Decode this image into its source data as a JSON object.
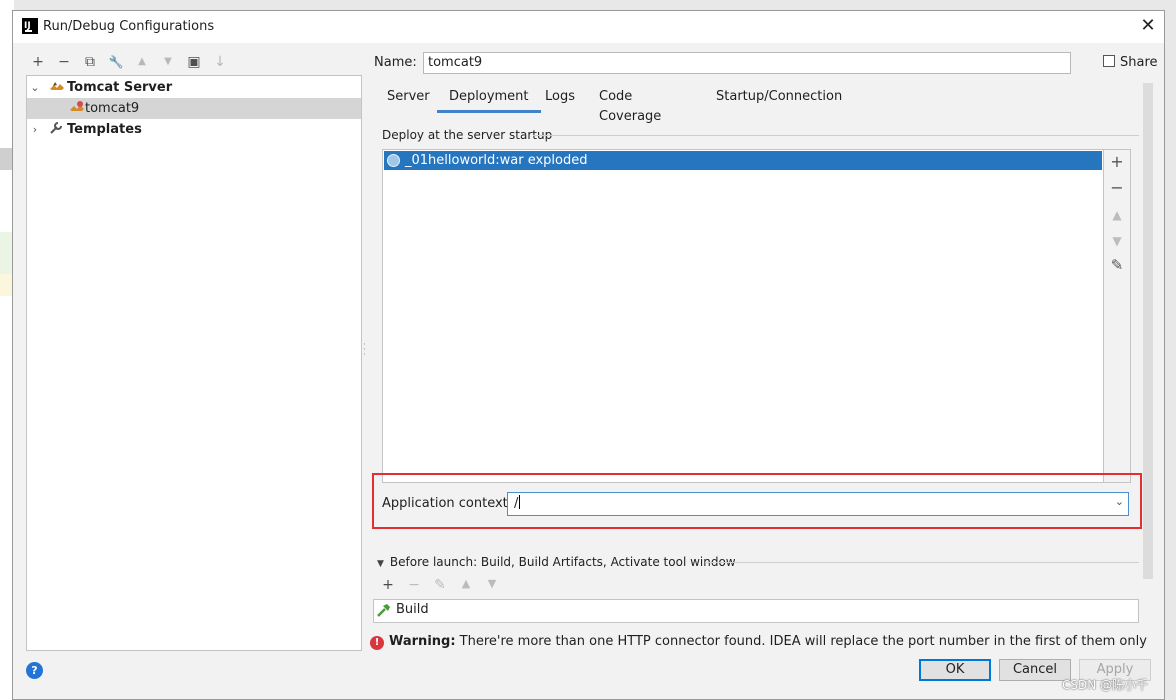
{
  "window": {
    "title": "Run/Debug Configurations",
    "app_icon_text": "IJ",
    "close_glyph": "✕"
  },
  "left_toolbar": {
    "add": "+",
    "remove": "−",
    "copy": "⧉",
    "edit_defaults": "🔧",
    "move_up": "▲",
    "move_down": "▼",
    "new_folder": "▣",
    "sort": "↓"
  },
  "tree": {
    "items": [
      {
        "label": "Tomcat Server",
        "chevron": "⌄"
      },
      {
        "label": "tomcat9"
      },
      {
        "label": "Templates",
        "chevron": "›"
      }
    ]
  },
  "config": {
    "name_label": "Name:",
    "name_value": "tomcat9",
    "share_label": "Share"
  },
  "tabs": [
    {
      "label": "Server"
    },
    {
      "label": "Deployment"
    },
    {
      "label": "Logs"
    },
    {
      "label": "Code Coverage"
    },
    {
      "label": "Startup/Connection"
    }
  ],
  "active_tab": "Deployment",
  "deployment": {
    "group_title": "Deploy at the server startup",
    "items": [
      "_01helloworld:war exploded"
    ],
    "side_tools": {
      "add": "+",
      "remove": "−",
      "up": "▲",
      "down": "▼",
      "edit": "✎"
    },
    "app_context_label": "Application context:",
    "app_context_value": "/",
    "dropdown_glyph": "⌄"
  },
  "before_launch": {
    "title": "Before launch: Build, Build Artifacts, Activate tool window",
    "toggle_glyph": "▼",
    "tools": {
      "add": "+",
      "remove": "−",
      "edit": "✎",
      "up": "▲",
      "down": "▼"
    },
    "items": [
      "Build"
    ]
  },
  "warning": {
    "icon_glyph": "!",
    "bold": "Warning:",
    "text": " There're more than one HTTP connector found. IDEA will replace the port number in the first of them only"
  },
  "footer": {
    "help_glyph": "?",
    "ok": "OK",
    "cancel": "Cancel",
    "apply": "Apply"
  },
  "watermark": "CSDN @陈小千",
  "colors": {
    "selection_blue": "#2675bf",
    "highlight_red": "#e03030",
    "tab_underline": "#4083c9",
    "warning_red": "#d9363e"
  }
}
